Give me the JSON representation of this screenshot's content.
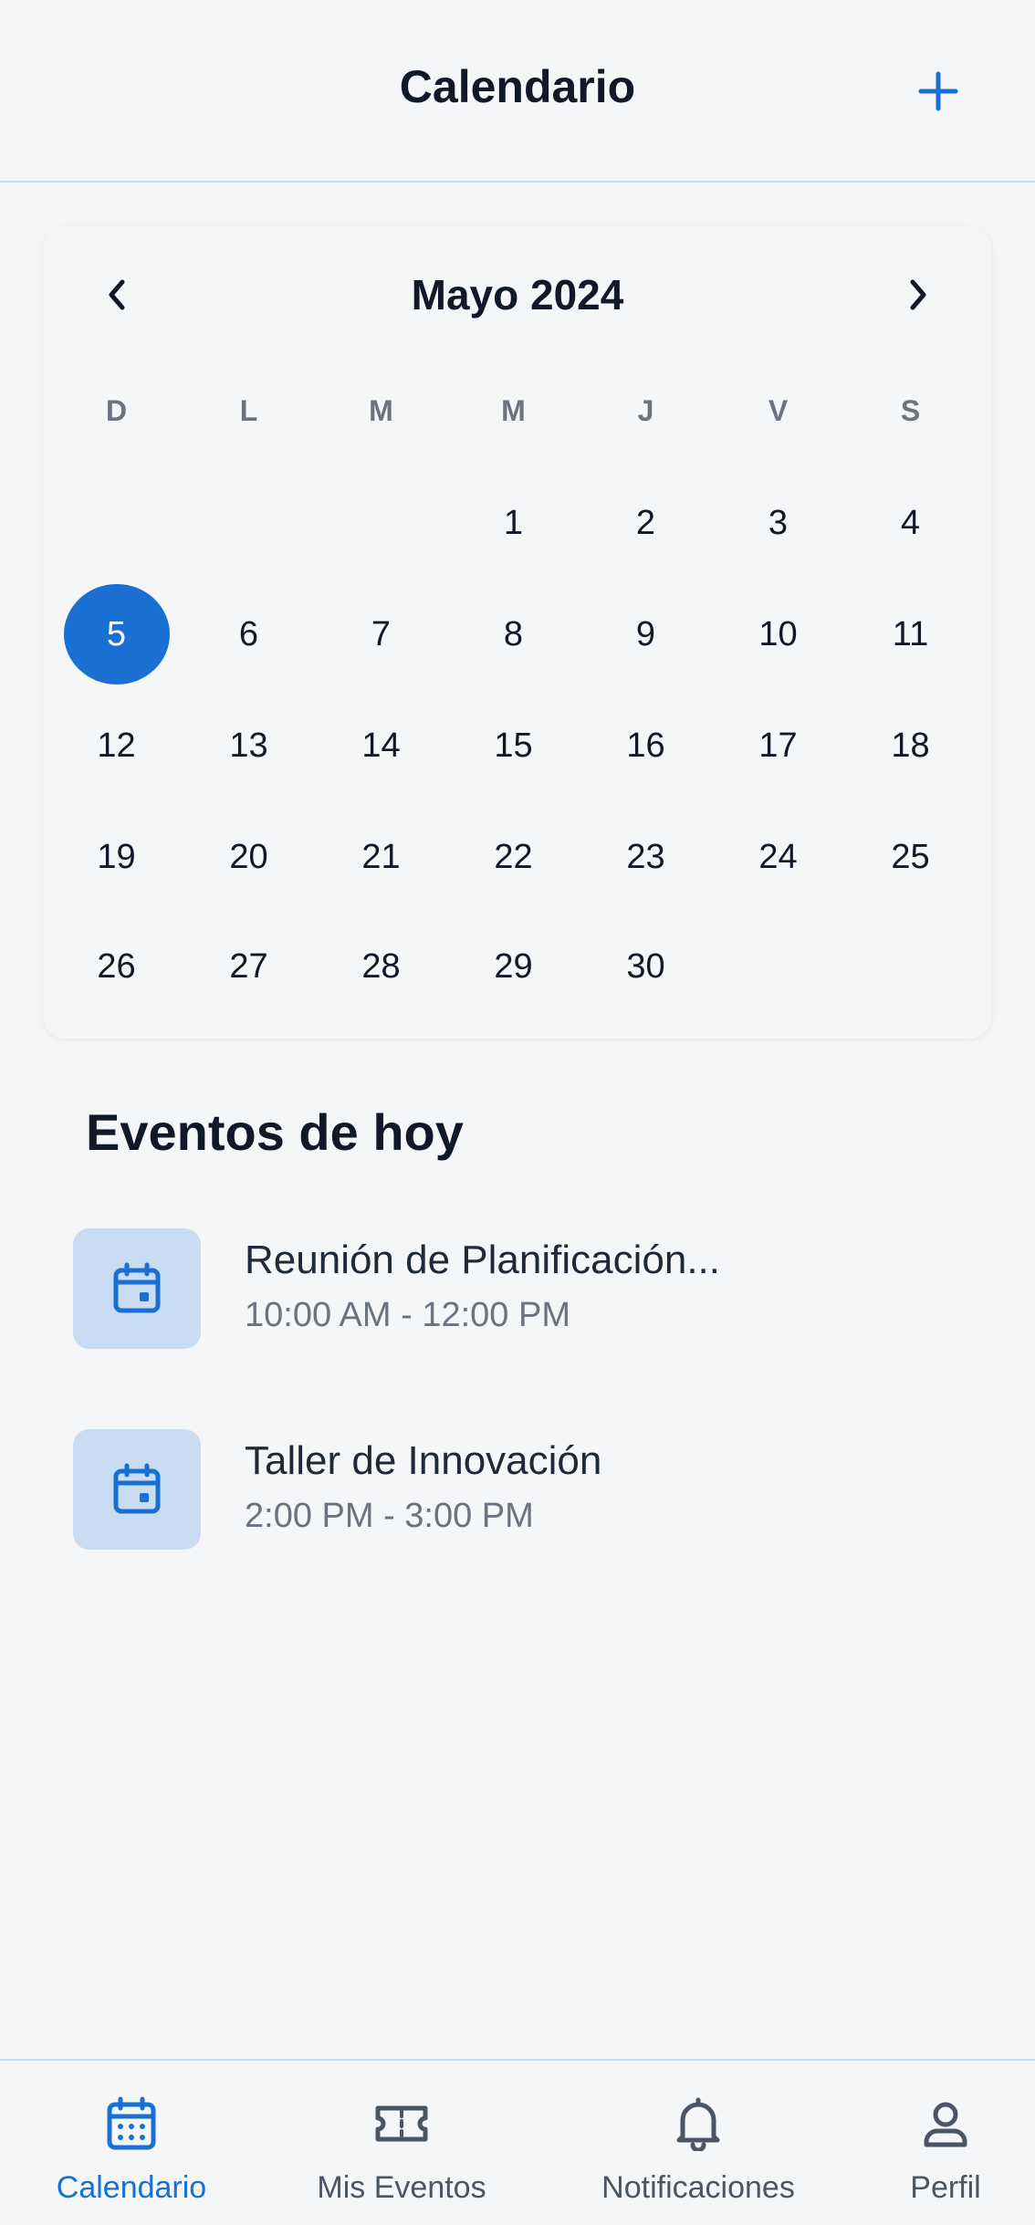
{
  "header": {
    "title": "Calendario",
    "add_icon": "plus-icon"
  },
  "calendar": {
    "month_label": "Mayo 2024",
    "prev_icon": "chevron-left-icon",
    "next_icon": "chevron-right-icon",
    "weekdays": [
      "D",
      "L",
      "M",
      "M",
      "J",
      "V",
      "S"
    ],
    "weeks": [
      [
        "",
        "",
        "",
        "1",
        "2",
        "3",
        "4"
      ],
      [
        "5",
        "6",
        "7",
        "8",
        "9",
        "10",
        "11"
      ],
      [
        "12",
        "13",
        "14",
        "15",
        "16",
        "17",
        "18"
      ],
      [
        "19",
        "20",
        "21",
        "22",
        "23",
        "24",
        "25"
      ],
      [
        "26",
        "27",
        "28",
        "29",
        "30",
        "",
        ""
      ]
    ],
    "selected_day": "5"
  },
  "events_section": {
    "title": "Eventos de hoy",
    "events": [
      {
        "title": "Reunión de Planificación...",
        "time": "10:00 AM - 12:00 PM",
        "icon": "calendar-event-icon"
      },
      {
        "title": "Taller de Innovación",
        "time": "2:00 PM - 3:00 PM",
        "icon": "calendar-event-icon"
      }
    ]
  },
  "tabbar": {
    "tabs": [
      {
        "label": "Calendario",
        "icon": "calendar-icon",
        "active": true
      },
      {
        "label": "Mis Eventos",
        "icon": "ticket-icon",
        "active": false
      },
      {
        "label": "Notificaciones",
        "icon": "bell-icon",
        "active": false
      },
      {
        "label": "Perfil",
        "icon": "user-icon",
        "active": false
      }
    ]
  },
  "colors": {
    "accent": "#1a6fd3",
    "accent_light": "#c9dcf2",
    "background": "#f5f6f8",
    "text": "#111827",
    "muted": "#6b7280"
  }
}
